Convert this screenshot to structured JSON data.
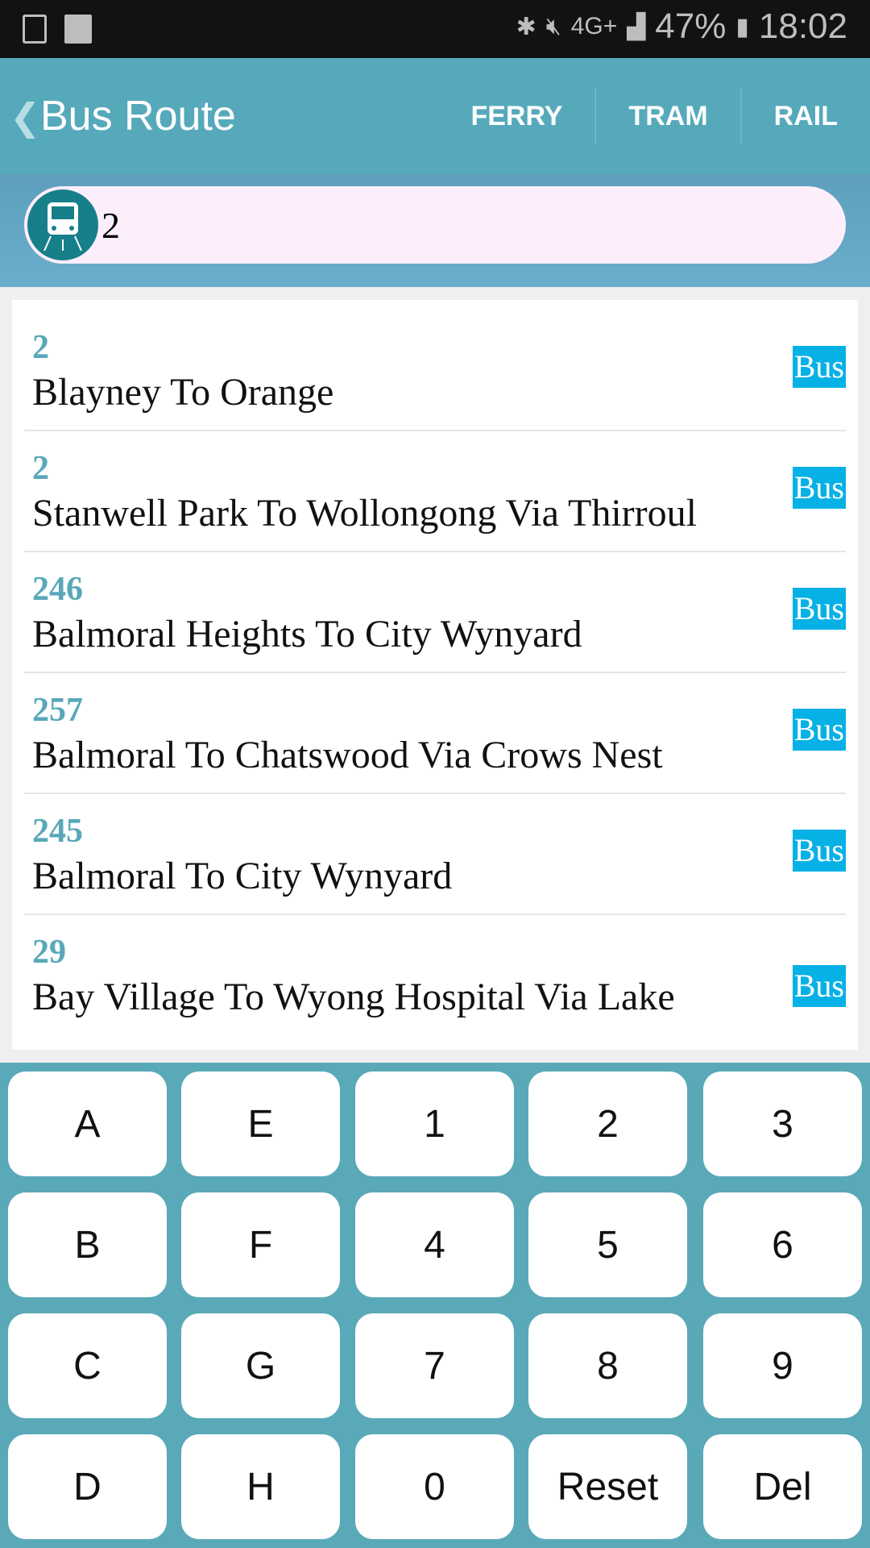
{
  "status": {
    "battery": "47%",
    "time": "18:02",
    "network": "4G+"
  },
  "header": {
    "title": "Bus Route",
    "tabs": [
      "FERRY",
      "TRAM",
      "RAIL"
    ]
  },
  "search": {
    "value": "2",
    "icon": "bus-icon"
  },
  "routes": [
    {
      "number": "2",
      "name": "Blayney To Orange",
      "type": "Bus"
    },
    {
      "number": "2",
      "name": "Stanwell Park To Wollongong Via Thirroul",
      "type": "Bus"
    },
    {
      "number": "246",
      "name": "Balmoral Heights To City Wynyard",
      "type": "Bus"
    },
    {
      "number": "257",
      "name": "Balmoral To Chatswood Via Crows Nest",
      "type": "Bus"
    },
    {
      "number": "245",
      "name": "Balmoral To City Wynyard",
      "type": "Bus"
    },
    {
      "number": "29",
      "name": "Bay Village To Wyong Hospital Via Lake",
      "type": "Bus"
    }
  ],
  "keypad": [
    [
      "A",
      "E",
      "1",
      "2",
      "3"
    ],
    [
      "B",
      "F",
      "4",
      "5",
      "6"
    ],
    [
      "C",
      "G",
      "7",
      "8",
      "9"
    ],
    [
      "D",
      "H",
      "0",
      "Reset",
      "Del"
    ]
  ],
  "colors": {
    "header": "#56a9bb",
    "badge": "#06b1e6",
    "route_number": "#58a8b9"
  }
}
